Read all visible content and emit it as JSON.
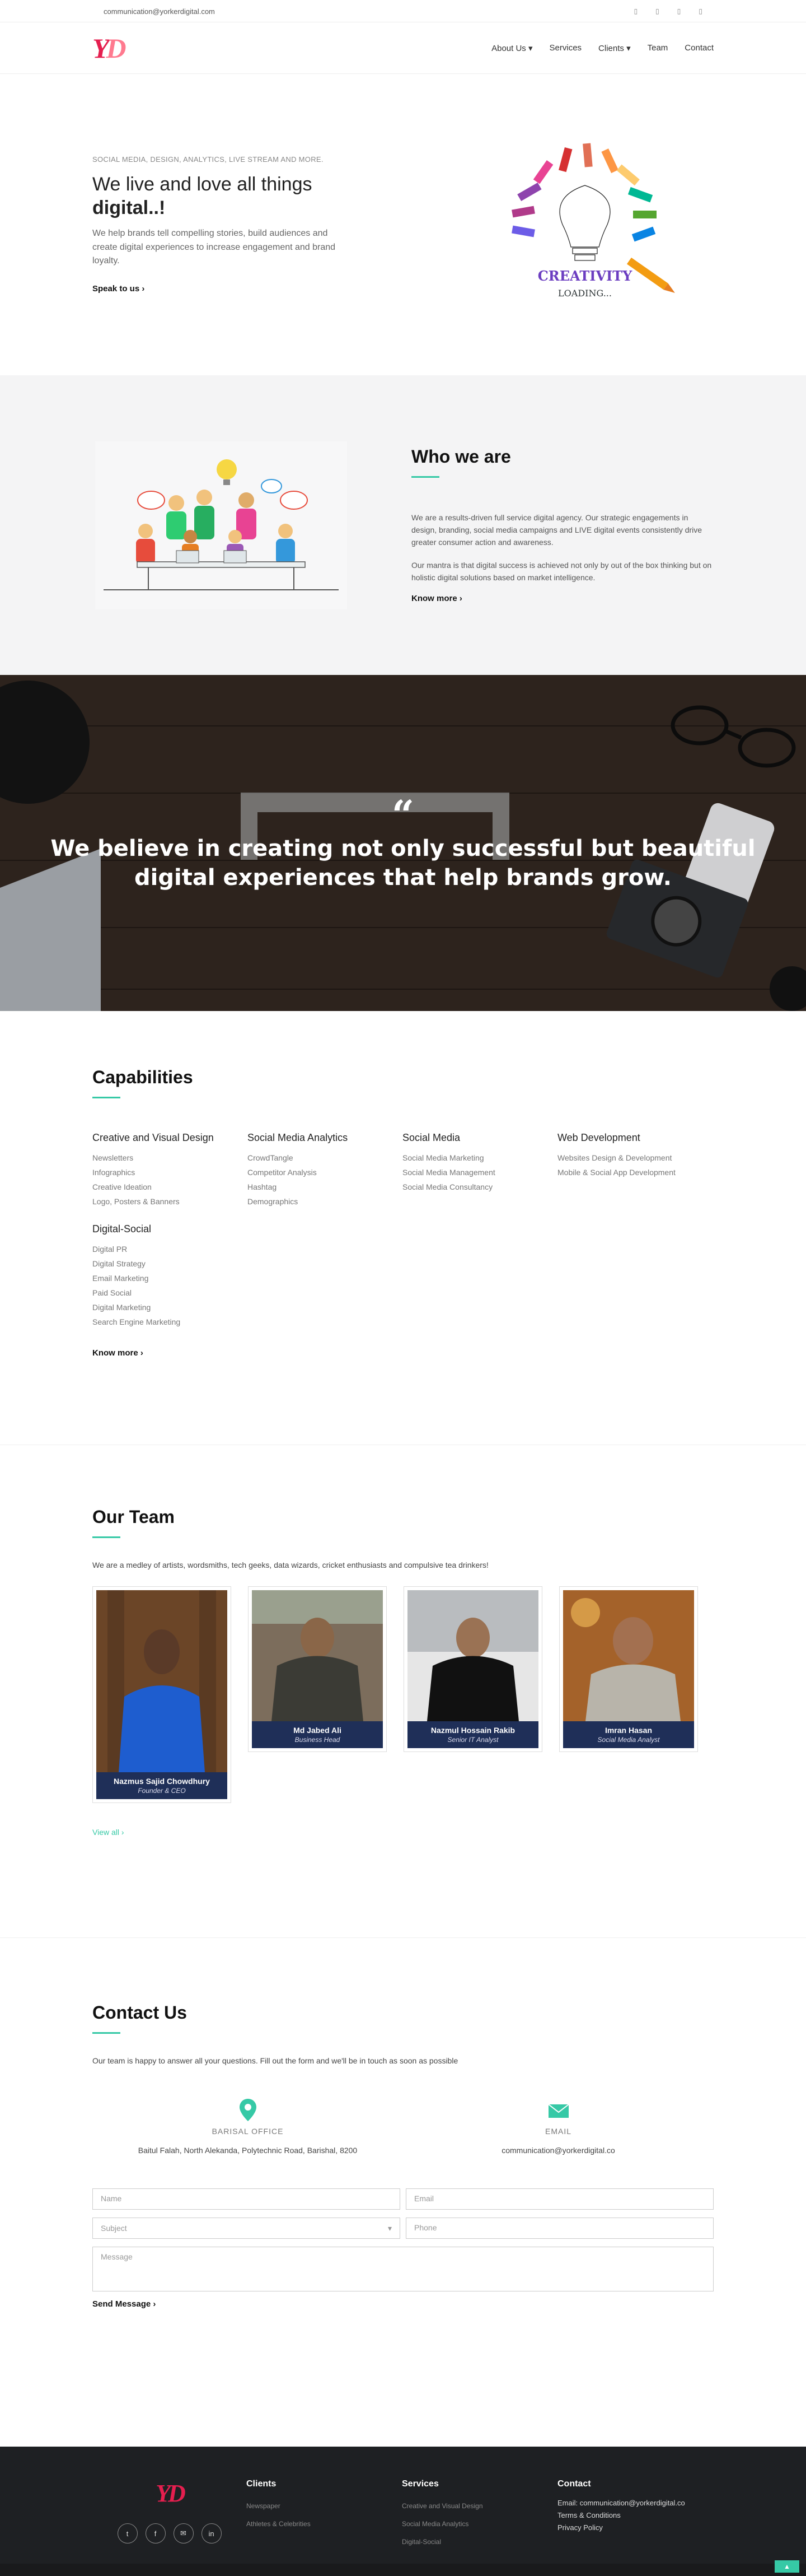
{
  "topbar": {
    "email": "communication@yorkerdigital.com",
    "social_icons": [
      "facebook-icon",
      "twitter-icon",
      "instagram-icon",
      "linkedin-icon"
    ]
  },
  "brand": {
    "logo_text": "YD",
    "colors": {
      "primary": "#e51f4f",
      "accent": "#36c9a6",
      "navy": "#1f2f58"
    }
  },
  "nav": [
    {
      "label": "About Us"
    },
    {
      "label": "Services"
    },
    {
      "label": "Clients"
    },
    {
      "label": "Team"
    },
    {
      "label": "Contact"
    }
  ],
  "hero": {
    "eyebrow": "SOCIAL MEDIA, DESIGN, ANALYTICS, LIVE STREAM AND MORE.",
    "title_line1": "We live and love all things",
    "title_line2": "digital..!",
    "description": "We help brands tell compelling stories, build audiences and create digital experiences to increase engagement and brand loyalty.",
    "cta": "Speak to us",
    "art_text1": "CREATIVITY",
    "art_text2": "LOADING..."
  },
  "who": {
    "title": "Who we are",
    "p1": "We are a results-driven full service digital agency. Our strategic engagements in design, branding, social media campaigns and LIVE digital events consistently drive greater consumer action and awareness.",
    "p2": "Our mantra is that digital success is achieved not only by out of the box thinking but on holistic digital solutions based on market intelligence.",
    "cta": "Know more"
  },
  "quote": {
    "text_line1": "We believe in creating not only successful but beautiful",
    "text_line2": "digital experiences that help brands grow."
  },
  "capabilities": {
    "title": "Capabilities",
    "groups": [
      {
        "title": "Creative and Visual Design",
        "items": [
          "Newsletters",
          "Infographics",
          "Creative Ideation",
          "Logo, Posters & Banners"
        ]
      },
      {
        "title": "Social Media Analytics",
        "items": [
          "CrowdTangle",
          "Competitor Analysis",
          "Hashtag",
          "Demographics"
        ]
      },
      {
        "title": "Social Media",
        "items": [
          "Social Media Marketing",
          "Social Media Management",
          "Social Media Consultancy"
        ]
      },
      {
        "title": "Web Development",
        "items": [
          "Websites Design & Development",
          "Mobile & Social App Development"
        ]
      },
      {
        "title": "Digital-Social",
        "items": [
          "Digital PR",
          "Digital Strategy",
          "Email Marketing",
          "Paid Social",
          "Digital Marketing",
          "Search Engine Marketing"
        ]
      }
    ],
    "cta": "Know more"
  },
  "team": {
    "title": "Our Team",
    "intro": "We are a medley of artists, wordsmiths, tech geeks, data wizards, cricket enthusiasts and compulsive tea drinkers!",
    "members": [
      {
        "name": "Nazmus Sajid Chowdhury",
        "role": "Founder & CEO"
      },
      {
        "name": "Md Jabed Ali",
        "role": "Business Head"
      },
      {
        "name": "Nazmul Hossain Rakib",
        "role": "Senior IT Analyst"
      },
      {
        "name": "Imran Hasan",
        "role": "Social Media Analyst"
      }
    ],
    "view_all": "View all"
  },
  "contact": {
    "title": "Contact Us",
    "intro": "Our team is happy to answer all your questions. Fill out the form and we'll be in touch as soon as possible",
    "office_label": "BARISAL OFFICE",
    "office_address": "Baitul Falah, North Alekanda, Polytechnic Road, Barishal, 8200",
    "email_label": "EMAIL",
    "email_value": "communication@yorkerdigital.co",
    "form": {
      "name_placeholder": "Name",
      "email_placeholder": "Email",
      "subject_placeholder": "Subject",
      "phone_placeholder": "Phone",
      "message_placeholder": "Message",
      "send": "Send Message"
    }
  },
  "footer": {
    "logo_text": "YD",
    "socials": [
      "twitter-icon",
      "facebook-icon",
      "email-icon",
      "linkedin-icon"
    ],
    "clients_title": "Clients",
    "clients": [
      "Newspaper",
      "Athletes & Celebrities"
    ],
    "services_title": "Services",
    "services": [
      "Creative and Visual Design",
      "Social Media Analytics",
      "Digital-Social"
    ],
    "contact_title": "Contact",
    "contact_email": "Email: communication@yorkerdigital.co",
    "terms": "Terms & Conditions",
    "privacy": "Privacy Policy"
  }
}
